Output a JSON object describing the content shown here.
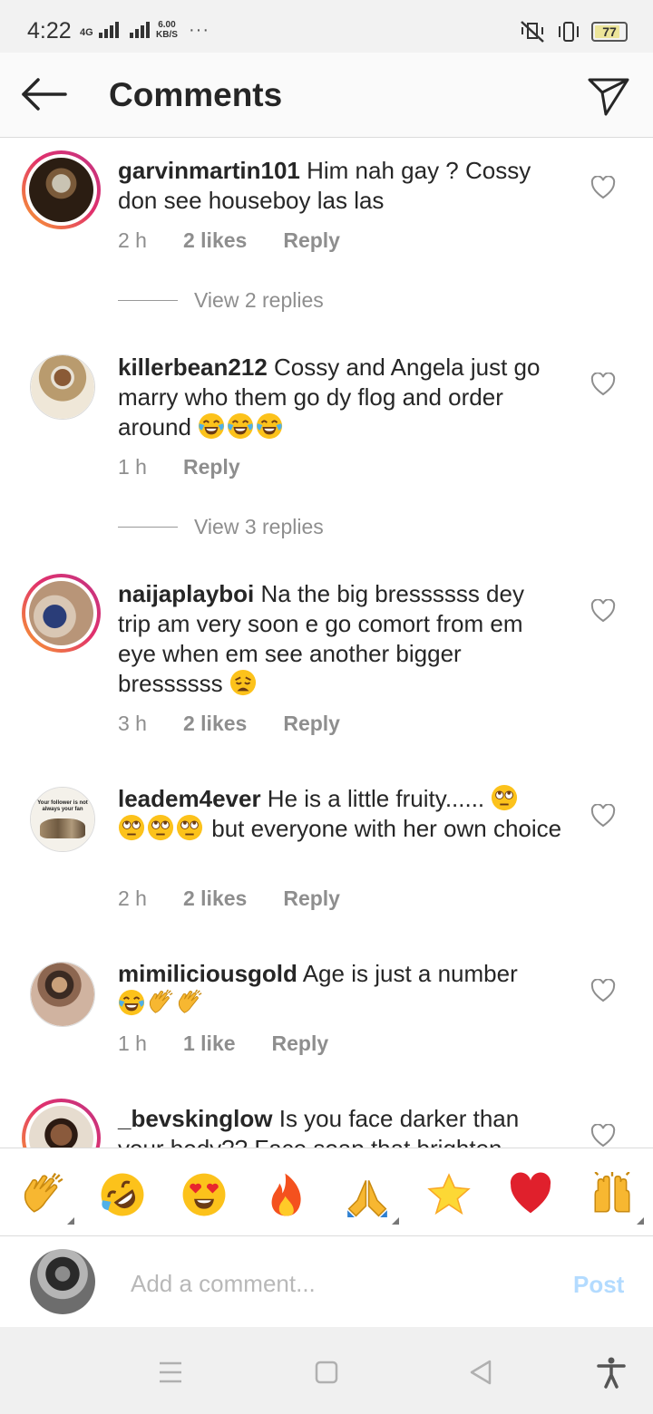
{
  "status_bar": {
    "time": "4:22",
    "network_label": "4G",
    "speed_value": "6.00",
    "speed_unit": "KB/S",
    "more": "···",
    "battery": "77"
  },
  "header": {
    "title": "Comments"
  },
  "comments": [
    {
      "username": "garvinmartin101",
      "text": "Him nah gay ? Cossy don see houseboy las las",
      "time": "2 h",
      "likes": "2 likes",
      "reply": "Reply",
      "view_replies": "View 2 replies"
    },
    {
      "username": "killerbean212",
      "text": "Cossy and Angela just go marry who them go dy flog and order around",
      "emojis": [
        "face-with-tears-of-joy",
        "face-with-tears-of-joy",
        "face-with-tears-of-joy"
      ],
      "time": "1 h",
      "reply": "Reply",
      "view_replies": "View 3 replies"
    },
    {
      "username": "naijaplayboi",
      "text": "Na the big bressssss dey trip am very soon e go comort from em eye when em see another bigger bressssss",
      "emojis": [
        "weary-face"
      ],
      "time": "3 h",
      "likes": "2 likes",
      "reply": "Reply"
    },
    {
      "username": "leadem4ever",
      "text_before": "He is a little fruity......",
      "text_after": "but everyone with her own choice",
      "emojis": [
        "face-with-rolling-eyes",
        "face-with-rolling-eyes",
        "face-with-rolling-eyes",
        "face-with-rolling-eyes"
      ],
      "avatar_caption_1": "Your follower is not",
      "avatar_caption_2": "always your fan",
      "time": "2 h",
      "likes": "2 likes",
      "reply": "Reply"
    },
    {
      "username": "mimiliciousgold",
      "text": "Age is just a number",
      "emojis": [
        "face-with-tears-of-joy",
        "clapping-hands",
        "clapping-hands"
      ],
      "time": "1 h",
      "likes": "1 like",
      "reply": "Reply"
    },
    {
      "username": "_bevskinglow",
      "text": "Is you face darker than your body?? Face soap that brighten"
    }
  ],
  "quick_emojis": [
    "clapping-hands",
    "rolling-on-floor-laughing",
    "heart-eyes",
    "fire",
    "folded-hands",
    "star",
    "red-heart",
    "raising-hands"
  ],
  "composer": {
    "placeholder": "Add a comment...",
    "post_label": "Post"
  },
  "colors": {
    "header_bg": "#fafafa",
    "text": "#262626",
    "meta": "#8e8e8e",
    "post_disabled": "#b3dbff",
    "ring_start": "#f9a12e",
    "ring_end": "#c13584"
  }
}
